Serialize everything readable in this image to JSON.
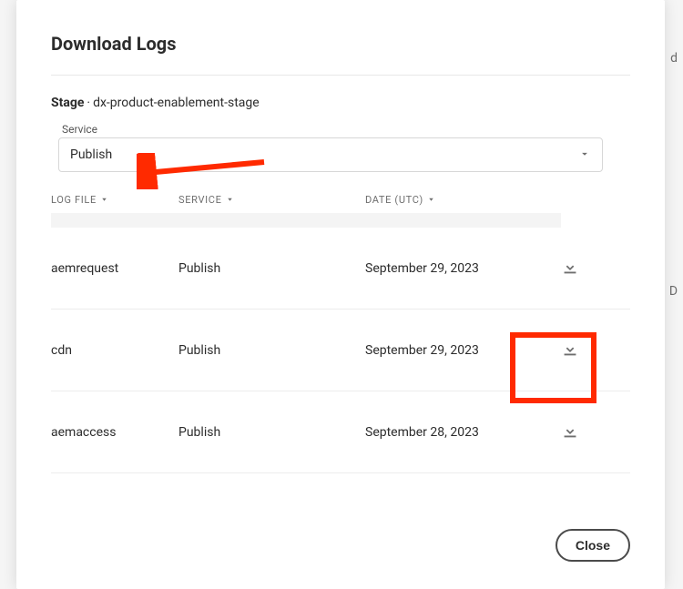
{
  "modal": {
    "title": "Download Logs",
    "stage_label": "Stage",
    "env_name": "dx-product-enablement-stage",
    "service_label": "Service",
    "service_selected": "Publish",
    "columns": {
      "log_file": "LOG FILE",
      "service": "SERVICE",
      "date": "DATE (UTC)"
    },
    "rows": [
      {
        "log_file": "aemrequest",
        "service": "Publish",
        "date": "September 29, 2023"
      },
      {
        "log_file": "cdn",
        "service": "Publish",
        "date": "September 29, 2023"
      },
      {
        "log_file": "aemaccess",
        "service": "Publish",
        "date": "September 28, 2023"
      }
    ],
    "close_label": "Close"
  },
  "backdrop": {
    "frag1": "d",
    "frag2": "D"
  }
}
